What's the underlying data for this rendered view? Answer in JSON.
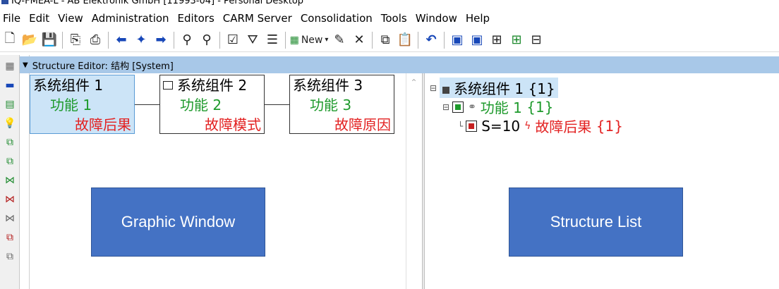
{
  "titlebar": {
    "text": "IQ-FMEA-L - AB Elektronik GmbH [11993-04] - Personal Desktop"
  },
  "menu": [
    "File",
    "Edit",
    "View",
    "Administration",
    "Editors",
    "CARM Server",
    "Consolidation",
    "Tools",
    "Window",
    "Help"
  ],
  "toolbar": {
    "new_label": "New"
  },
  "editor": {
    "header": "Structure Editor: 结构 [System]"
  },
  "graphic": {
    "nodes": [
      {
        "title": "系统组件 1",
        "function": "功能 1",
        "fault": "故障后果"
      },
      {
        "title": "系统组件 2",
        "function": "功能 2",
        "fault": "故障模式"
      },
      {
        "title": "系统组件 3",
        "function": "功能 3",
        "fault": "故障原因"
      }
    ],
    "callout": "Graphic Window"
  },
  "tree": {
    "root": {
      "label": "系统组件 1",
      "count": "{1}"
    },
    "function": {
      "label": "功能 1",
      "count": "{1}"
    },
    "failure": {
      "severity": "S=10",
      "label": "故障后果",
      "count": "{1}"
    },
    "callout": "Structure List"
  },
  "colors": {
    "header_bg": "#a8c8e8",
    "callout_bg": "#4472c4",
    "green": "#1e9a2c",
    "red": "#e32222",
    "selection": "#cce4f7"
  }
}
